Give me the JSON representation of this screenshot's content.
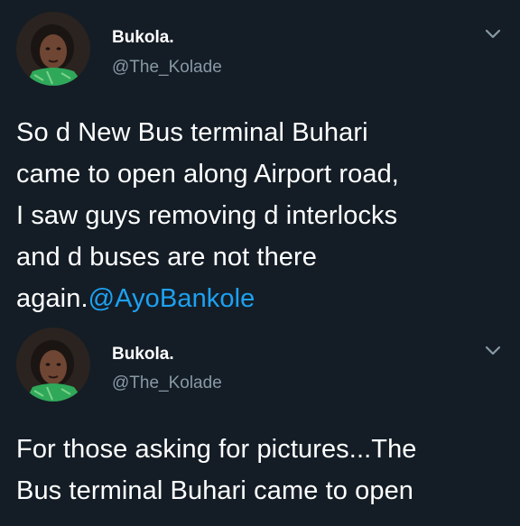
{
  "tweets": [
    {
      "author": {
        "name": "Bukola.",
        "handle": "@The_Kolade",
        "avatar": "profile-photo"
      },
      "text_lines": [
        "So d New Bus terminal Buhari",
        "came to open along Airport road,",
        "I saw guys removing d interlocks",
        "and d buses are not there"
      ],
      "last_line_prefix": "again.",
      "mention": "@AyoBankole",
      "menu_icon": "chevron-down-icon"
    },
    {
      "author": {
        "name": "Bukola.",
        "handle": "@The_Kolade",
        "avatar": "profile-photo"
      },
      "text_lines": [
        "For those asking for pictures...The",
        "Bus terminal Buhari came to open"
      ],
      "menu_icon": "chevron-down-icon"
    }
  ],
  "colors": {
    "background": "#141d26",
    "text": "#ffffff",
    "secondary": "#8899a6",
    "link": "#1da1f2"
  }
}
